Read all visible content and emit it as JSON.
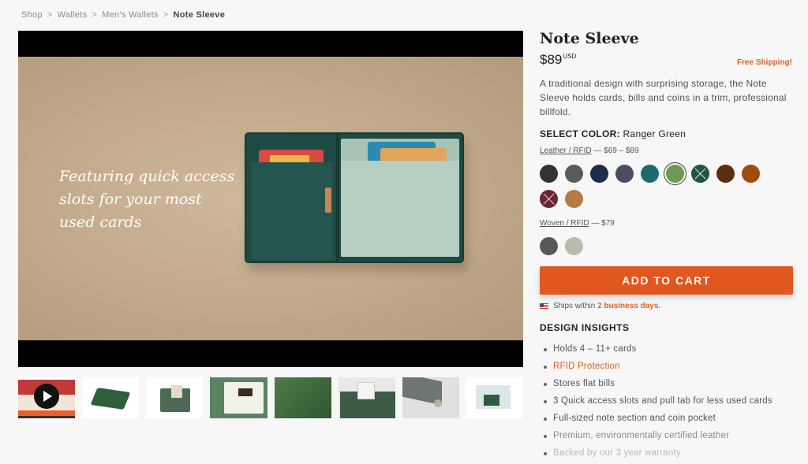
{
  "breadcrumb": [
    "Shop",
    "Wallets",
    "Men's Wallets",
    "Note Sleeve"
  ],
  "video": {
    "caption_lines": [
      "Featuring quick access",
      "slots for your most",
      "used cards"
    ]
  },
  "thumbnails": [
    "video-thumbnail",
    "wallet-closed",
    "wallet-open-cards",
    "wallet-interior",
    "wallet-leather-closeup",
    "wallet-note-section",
    "wallet-coin-pocket",
    "wallet-cards-layout"
  ],
  "product": {
    "title": "Note Sleeve",
    "price": "$89",
    "currency": "USD",
    "shipping": "Free Shipping!",
    "description": "A traditional design with surprising storage, the Note Sleeve holds cards, bills and coins in a trim, professional billfold."
  },
  "color": {
    "label": "SELECT COLOR:",
    "value": "Ranger Green",
    "groups": [
      {
        "name": "Leather / RFID",
        "price": " — $69 – $89",
        "swatches": [
          {
            "color": "#333333",
            "crossed": false,
            "selected": false
          },
          {
            "color": "#585b58",
            "crossed": false,
            "selected": false
          },
          {
            "color": "#1f2d4a",
            "crossed": false,
            "selected": false
          },
          {
            "color": "#4a4e62",
            "crossed": false,
            "selected": false
          },
          {
            "color": "#1f6b6b",
            "crossed": false,
            "selected": false
          },
          {
            "color": "#6f9a55",
            "crossed": false,
            "selected": true
          },
          {
            "color": "#23533f",
            "crossed": true,
            "selected": false
          },
          {
            "color": "#5a2e10",
            "crossed": false,
            "selected": false
          },
          {
            "color": "#a14a0c",
            "crossed": false,
            "selected": false
          },
          {
            "color": "#6b2530",
            "crossed": true,
            "selected": false
          },
          {
            "color": "#b87a45",
            "crossed": false,
            "selected": false
          }
        ]
      },
      {
        "name": "Woven / RFID",
        "price": " — $79",
        "swatches": [
          {
            "color": "#555856",
            "crossed": false,
            "selected": false
          },
          {
            "color": "#b8bcaa",
            "crossed": false,
            "selected": false
          }
        ]
      }
    ]
  },
  "cart": {
    "label": "ADD TO CART"
  },
  "ships": {
    "prefix": "Ships within",
    "days": "2 business days",
    "suffix": "."
  },
  "insights": {
    "title": "DESIGN INSIGHTS",
    "items": [
      "Holds 4 – 11+ cards",
      "RFID Protection",
      "Stores flat bills",
      "3 Quick access slots and pull tab for less used cards",
      "Full-sized note section and coin pocket",
      "Premium, environmentally certified leather",
      "Backed by our 3 year warranty"
    ]
  }
}
